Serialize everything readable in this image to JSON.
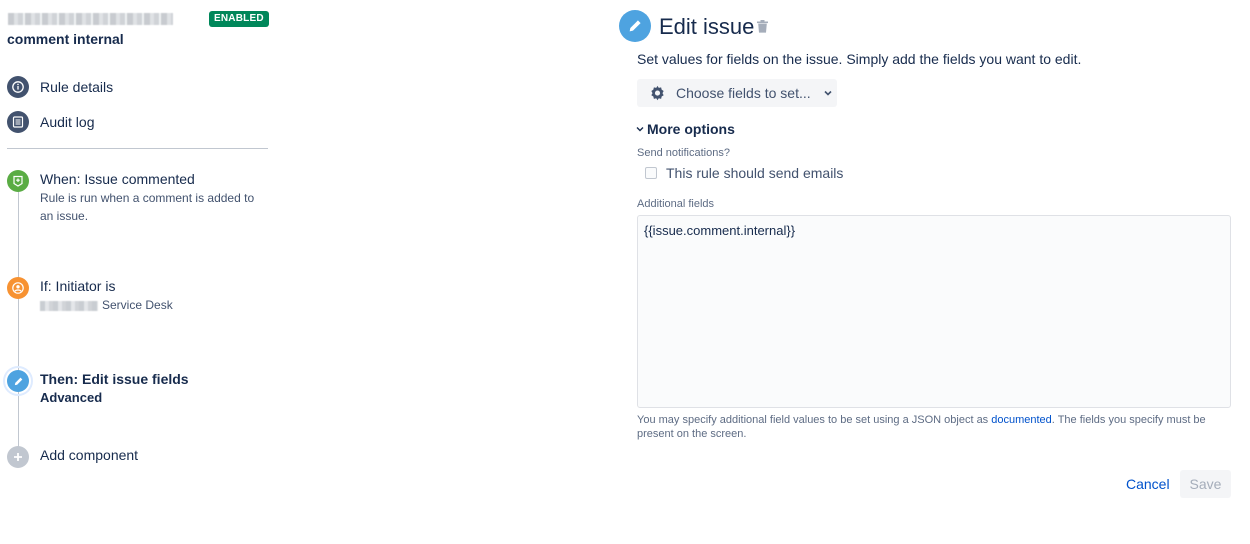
{
  "sidebar": {
    "badge": "ENABLED",
    "rule_subtitle": "comment internal",
    "nav": [
      {
        "label": "Rule details",
        "icon": "info-icon"
      },
      {
        "label": "Audit log",
        "icon": "list-icon"
      }
    ],
    "components": [
      {
        "title": "When: Issue commented",
        "desc": "Rule is run when a comment is added to an issue.",
        "icon": "trigger-icon",
        "color": "#5aac44"
      },
      {
        "title": "If: Initiator is",
        "desc": "Service Desk",
        "icon": "user-icon",
        "color": "#f79232"
      },
      {
        "title": "Then: Edit issue fields",
        "desc": "Advanced",
        "icon": "pencil-icon",
        "color": "#4ea3e0",
        "selected": true
      },
      {
        "title": "Add component",
        "icon": "plus-icon",
        "color": "#c1c7d0"
      }
    ]
  },
  "panel": {
    "title": "Edit issue",
    "description": "Set values for fields on the issue. Simply add the fields you want to edit.",
    "choose_fields_label": "Choose fields to set...",
    "more_options_label": "More options",
    "send_notifications_label": "Send notifications?",
    "send_emails_label": "This rule should send emails",
    "send_emails_checked": false,
    "additional_fields_label": "Additional fields",
    "additional_fields_value": "{{issue.comment.internal}}",
    "help_text_before": "You may specify additional field values to be set using a JSON object as ",
    "help_link": "documented",
    "help_text_after": ". The fields you specify must be present on the screen.",
    "cancel_label": "Cancel",
    "save_label": "Save"
  },
  "colors": {
    "accent": "#4ea3e0",
    "badge": "#00875a",
    "link": "#0052cc",
    "trigger": "#5aac44",
    "condition": "#f79232"
  }
}
